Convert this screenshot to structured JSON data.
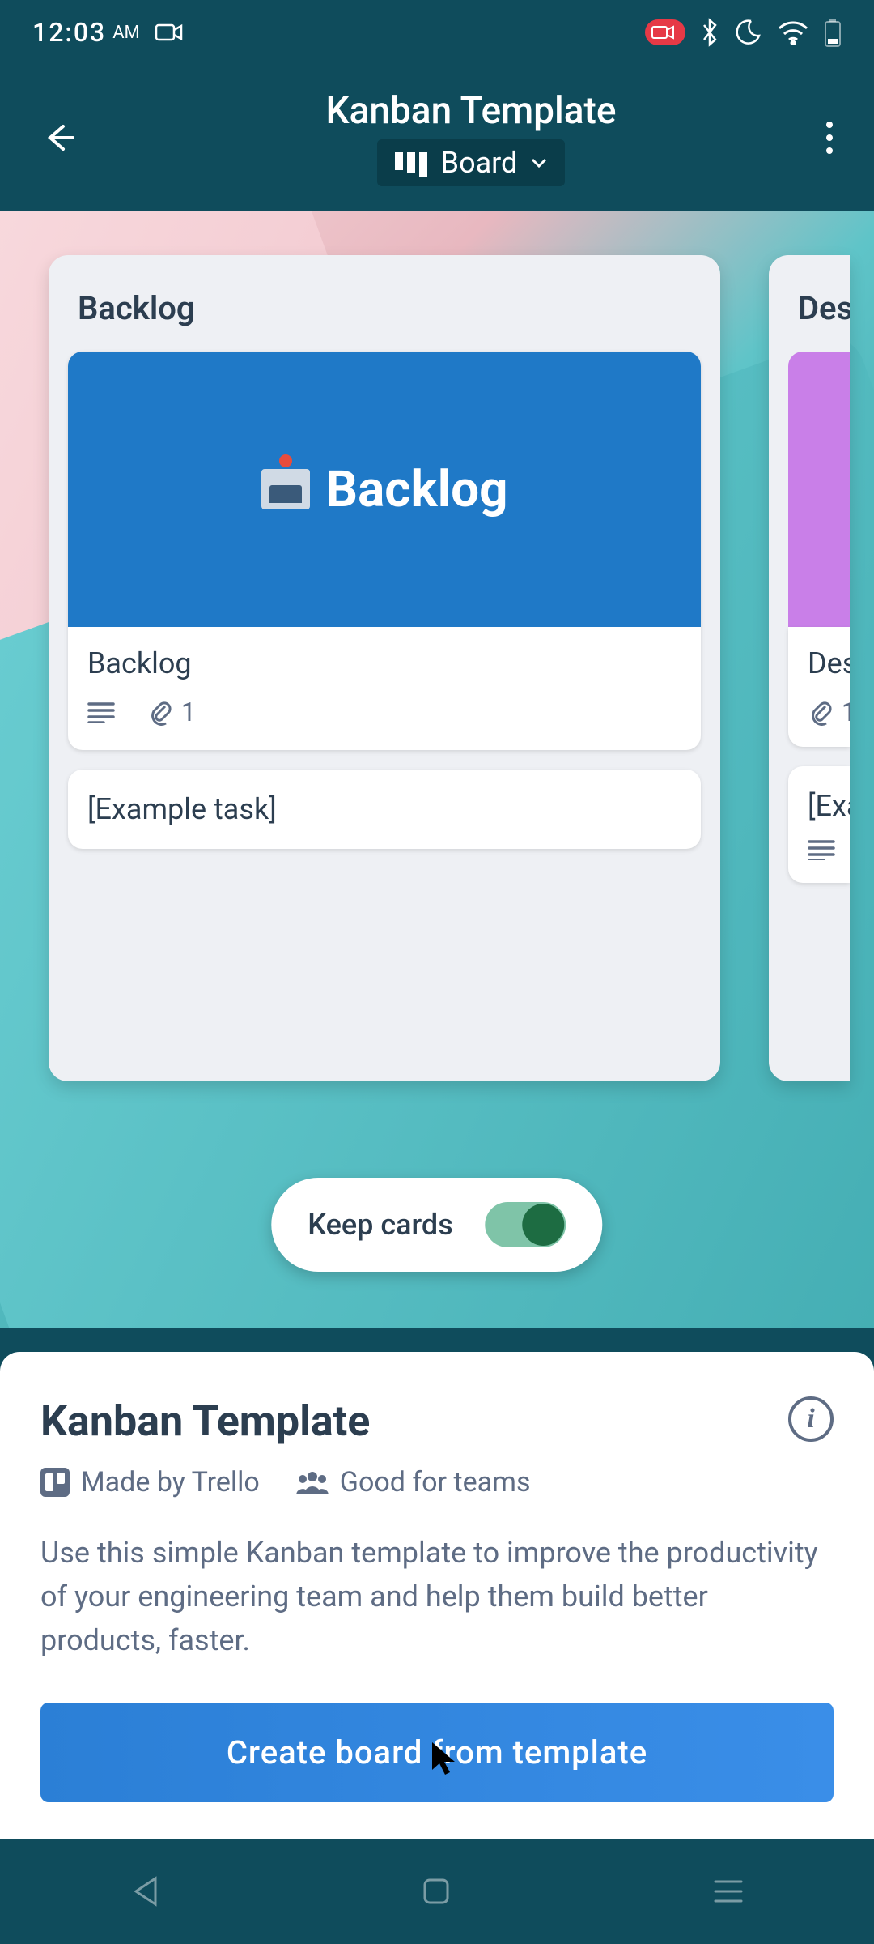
{
  "status": {
    "time": "12:03",
    "ampm": "AM"
  },
  "header": {
    "title": "Kanban Template",
    "view_label": "Board"
  },
  "lists": [
    {
      "title": "Backlog",
      "cards": [
        {
          "cover_label": "Backlog",
          "title": "Backlog",
          "attachments": "1"
        },
        {
          "title": "[Example task]"
        }
      ]
    },
    {
      "title": "Des",
      "cards": [
        {
          "title": "Des",
          "attachments": "1"
        },
        {
          "title": "[Exa"
        }
      ]
    }
  ],
  "keep_cards": {
    "label": "Keep cards",
    "on": true
  },
  "info": {
    "title": "Kanban Template",
    "made_by": "Made by Trello",
    "good_for": "Good for teams",
    "description": "Use this simple Kanban template to improve the productivity of your engineering team and help them build better products, faster.",
    "cta": "Create board from template"
  }
}
